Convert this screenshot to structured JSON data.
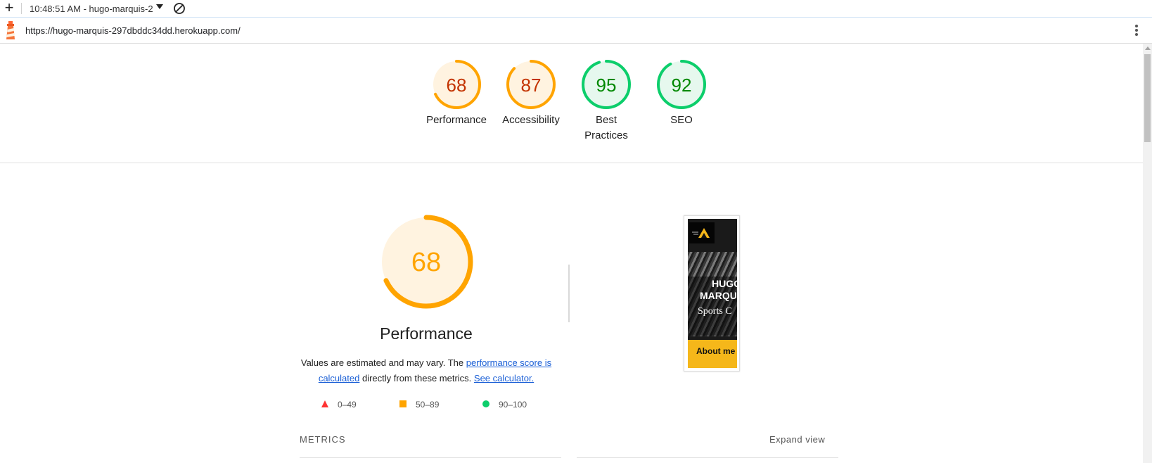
{
  "toolbar": {
    "new_icon": "plus-icon",
    "report_select": "10:48:51 AM - hugo-marquis-2",
    "clear_icon": "block-icon"
  },
  "urlbar": {
    "logo_icon": "lighthouse-icon",
    "url": "https://hugo-marquis-297dbddc34dd.herokuapp.com/",
    "menu_icon": "kebab-menu-icon"
  },
  "colors": {
    "average_fg": "#c33300",
    "average_ring": "#ffa400",
    "average_bg": "#fff3e0",
    "pass_fg": "#008800",
    "pass_ring": "#0cce6b",
    "pass_bg": "#e6f8ee",
    "fail": "#ff3333",
    "link": "#1a5fd6"
  },
  "scores": [
    {
      "value": 68,
      "label": "Performance",
      "status": "average"
    },
    {
      "value": 87,
      "label": "Accessibility",
      "status": "average"
    },
    {
      "value": 95,
      "label": "Best Practices",
      "status": "pass"
    },
    {
      "value": 92,
      "label": "SEO",
      "status": "pass"
    }
  ],
  "performance": {
    "score": 68,
    "title": "Performance",
    "desc_prefix": "Values are estimated and may vary. The ",
    "link_score": "performance score is calculated",
    "desc_mid": " directly from these metrics. ",
    "link_calc": "See calculator."
  },
  "legend": [
    {
      "range": "0–49",
      "shape": "triangle"
    },
    {
      "range": "50–89",
      "shape": "square"
    },
    {
      "range": "90–100",
      "shape": "circle"
    }
  ],
  "screenshot": {
    "title_line1": "HUGO",
    "title_line2": "MARQU",
    "subtitle": "Sports C",
    "button": "About me"
  },
  "metrics": {
    "heading": "METRICS",
    "expand": "Expand view"
  }
}
